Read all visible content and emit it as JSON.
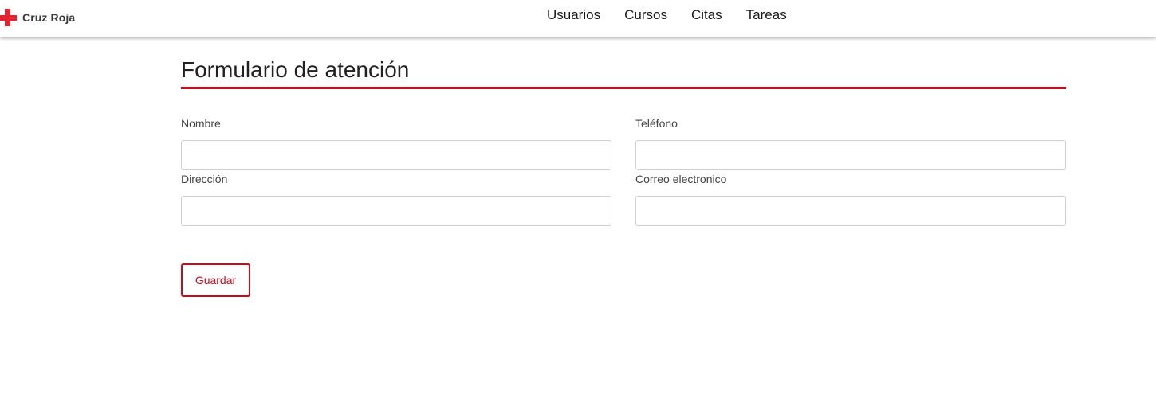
{
  "brand": {
    "name": "Cruz Roja",
    "icon": "red-cross-icon",
    "color": "#e52330"
  },
  "nav": {
    "items": [
      {
        "label": "Usuarios"
      },
      {
        "label": "Cursos"
      },
      {
        "label": "Citas"
      },
      {
        "label": "Tareas"
      }
    ]
  },
  "page": {
    "title": "Formulario de atención",
    "accent_color": "#cc0a1d"
  },
  "form": {
    "fields": [
      {
        "label": "Nombre",
        "value": ""
      },
      {
        "label": "Teléfono",
        "value": ""
      },
      {
        "label": "Dirección",
        "value": ""
      },
      {
        "label": "Correo electronico",
        "value": ""
      }
    ],
    "save_label": "Guardar"
  }
}
